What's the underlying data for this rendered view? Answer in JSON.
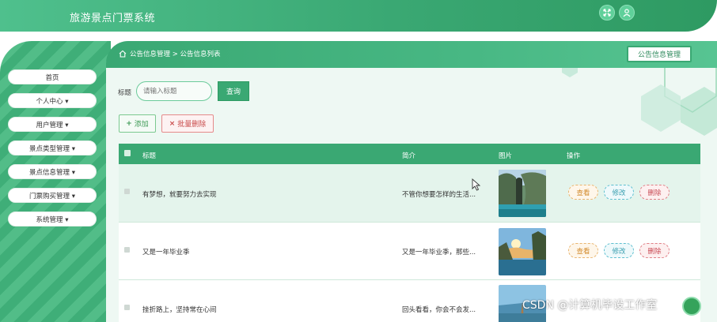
{
  "app": {
    "title": "旅游景点门票系统"
  },
  "header": {
    "icons": [
      "fullscreen-icon",
      "user-icon"
    ]
  },
  "sidebar": {
    "items": [
      {
        "label": "首页"
      },
      {
        "label": "个人中心 ▾"
      },
      {
        "label": "用户管理 ▾"
      },
      {
        "label": "景点类型管理 ▾"
      },
      {
        "label": "景点信息管理 ▾"
      },
      {
        "label": "门票购买管理 ▾"
      },
      {
        "label": "系统管理 ▾"
      }
    ]
  },
  "breadcrumb": {
    "path": "公告信息管理 > 公告信息列表"
  },
  "module_button": "公告信息管理",
  "search": {
    "label": "标题",
    "placeholder": "请输入标题",
    "button": "查询"
  },
  "toolbar": {
    "add": "添加",
    "bulk_delete": "批量删除"
  },
  "table": {
    "headers": {
      "title": "标题",
      "intro": "简介",
      "image": "图片",
      "actions": "操作"
    },
    "rows": [
      {
        "title": "有梦想，就要努力去实现",
        "intro": "不管你想要怎样的生活..."
      },
      {
        "title": "又是一年毕业季",
        "intro": "又是一年毕业季，那些..."
      },
      {
        "title": "挫折路上，坚持常在心间",
        "intro": "回头看看，你会不会发..."
      }
    ],
    "actions": {
      "view": "查看",
      "edit": "修改",
      "delete": "删除"
    }
  },
  "watermark": "CSDN @计算机毕设工作室",
  "colors": {
    "primary": "#3aa873",
    "view": "#d28a2c",
    "edit": "#3a9fb0",
    "delete": "#c84a54"
  }
}
